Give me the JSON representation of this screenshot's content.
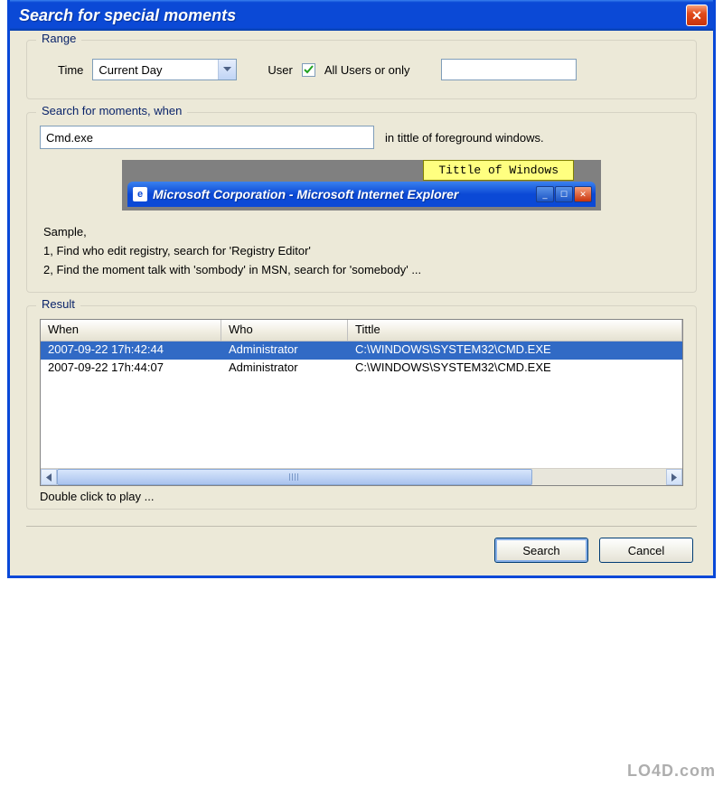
{
  "window": {
    "title": "Search for special moments"
  },
  "range": {
    "legend": "Range",
    "time_label": "Time",
    "time_value": "Current Day",
    "user_label": "User",
    "all_users_checked": true,
    "all_users_label": "All Users or only",
    "user_filter_value": ""
  },
  "search": {
    "legend": "Search for moments, when",
    "query": "Cmd.exe",
    "suffix": "in tittle of foreground windows.",
    "tooltip": "Tittle of Windows",
    "ie_title": "Microsoft Corporation - Microsoft Internet Explorer",
    "sample_heading": "Sample,",
    "sample1": "1, Find who edit registry, search for 'Registry Editor'",
    "sample2": "2, Find the moment talk with 'sombody' in MSN, search for 'somebody' ..."
  },
  "result": {
    "legend": "Result",
    "columns": {
      "when": "When",
      "who": "Who",
      "title": "Tittle"
    },
    "rows": [
      {
        "when": "2007-09-22 17h:42:44",
        "who": "Administrator",
        "title": "C:\\WINDOWS\\SYSTEM32\\CMD.EXE",
        "selected": true
      },
      {
        "when": "2007-09-22 17h:44:07",
        "who": "Administrator",
        "title": "C:\\WINDOWS\\SYSTEM32\\CMD.EXE",
        "selected": false
      }
    ],
    "hint": "Double click to play ..."
  },
  "buttons": {
    "search": "Search",
    "cancel": "Cancel"
  },
  "watermark": "LO4D.com"
}
